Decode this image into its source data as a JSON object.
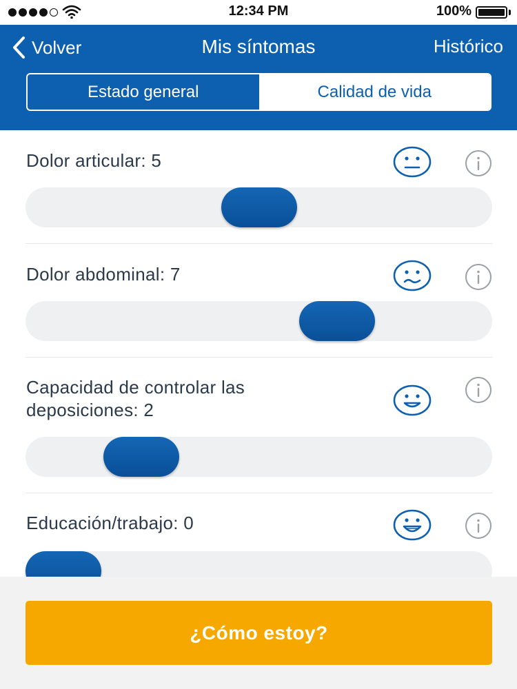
{
  "status_bar": {
    "time": "12:34 PM",
    "battery": "100%",
    "signal_dots": 5,
    "signal_filled": 4
  },
  "nav": {
    "back_label": "Volver",
    "title": "Mis síntomas",
    "history_label": "Histórico",
    "tabs": [
      {
        "label": "Estado general",
        "active": false
      },
      {
        "label": "Calidad de vida",
        "active": true
      }
    ]
  },
  "symptoms": [
    {
      "label": "Dolor articular: 5",
      "value": 5,
      "max": 10,
      "face": "neutral-face-icon"
    },
    {
      "label": "Dolor abdominal: 7",
      "value": 7,
      "max": 10,
      "face": "wavy-mouth-face-icon"
    },
    {
      "label": "Capacidad de controlar las deposiciones: 2",
      "value": 2,
      "max": 10,
      "face": "smiling-face-icon"
    },
    {
      "label": "Educación/trabajo: 0",
      "value": 0,
      "max": 10,
      "face": "grinning-face-icon"
    }
  ],
  "cta_label": "¿Cómo estoy?",
  "colors": {
    "brand_blue": "#0d5fb0",
    "accent_orange": "#f6a800",
    "track_grey": "#eef0f2",
    "info_grey": "#9aa0a6"
  }
}
